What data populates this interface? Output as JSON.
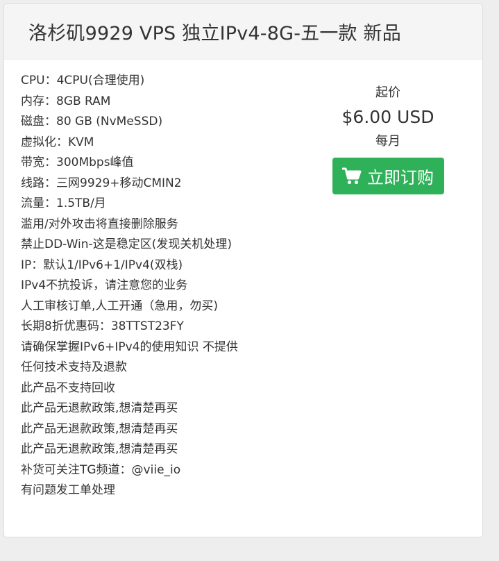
{
  "product": {
    "title": "洛杉矶9929 VPS 独立IPv4-8G-五一款 新品",
    "features": [
      "CPU：4CPU(合理使用)",
      "内存：8GB RAM",
      "磁盘：80 GB (NvMeSSD)",
      "虚拟化：KVM",
      "带宽：300Mbps峰值",
      "线路：三网9929+移动CMIN2",
      "流量：1.5TB/月",
      "滥用/对外攻击将直接删除服务",
      "禁止DD-Win-这是稳定区(发现关机处理)",
      "IP：默认1/IPv6+1/IPv4(双栈)",
      "IPv4不抗投诉，请注意您的业务",
      "人工审核订单,人工开通（急用，勿买)",
      "长期8折优惠码：38TTST23FY",
      "请确保掌握IPv6+IPv4的使用知识 不提供",
      "任何技术支持及退款",
      "此产品不支持回收",
      "此产品无退款政策,想清楚再买",
      "此产品无退款政策,想清楚再买",
      "此产品无退款政策,想清楚再买",
      "补货可关注TG频道：@viie_io",
      "有问题发工单处理"
    ]
  },
  "pricing": {
    "from_label": "起价",
    "amount": "$6.00 USD",
    "period": "每月"
  },
  "order_button": {
    "icon": "shopping-cart-icon",
    "label": "立即订购"
  },
  "colors": {
    "button": "#2fb15a",
    "header_bg": "#f5f5f5",
    "page_bg": "#eeeeee",
    "text": "#333333"
  }
}
